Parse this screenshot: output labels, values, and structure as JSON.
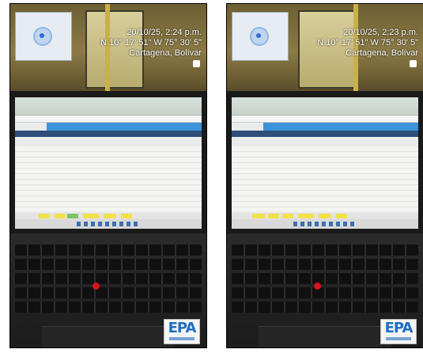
{
  "photos": [
    {
      "timestamp": "20/10/25, 2:24 p.m.",
      "coordinates": "N 10° 17' 51\" W 75° 30' 5\"",
      "location": "Cartagena, Bolívar",
      "logo": "EPA"
    },
    {
      "timestamp": "20/10/25, 2:23 p.m.",
      "coordinates": "N 10° 17' 51\" W 75° 30' 5\"",
      "location": "Cartagena, Bolívar",
      "logo": "EPA"
    }
  ],
  "colors": {
    "logo_blue": "#1e6fc2",
    "trackpoint_red": "#d4141c",
    "sheet_blue": "#3d93d8"
  },
  "icons": [
    "map-pin-icon",
    "trackpoint-icon"
  ]
}
